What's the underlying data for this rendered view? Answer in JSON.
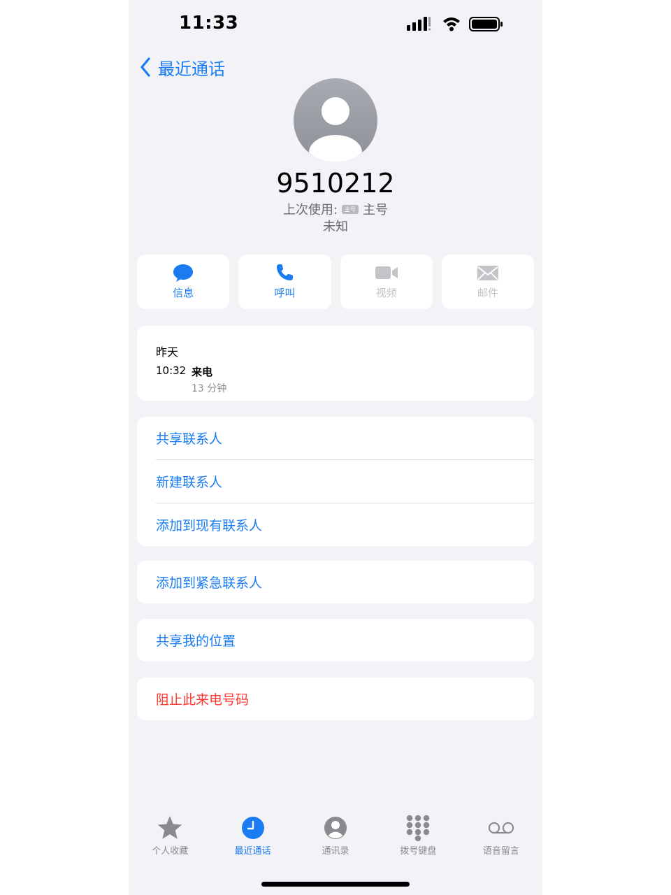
{
  "status_bar": {
    "time": "11:33"
  },
  "nav": {
    "back_label": "最近通话"
  },
  "contact": {
    "number": "9510212",
    "last_used_prefix": "上次使用:",
    "last_used_badge": "主号",
    "last_used_line": "主号",
    "location": "未知"
  },
  "actions": [
    {
      "label": "信息",
      "icon": "message-bubble-icon",
      "enabled": true
    },
    {
      "label": "呼叫",
      "icon": "phone-icon",
      "enabled": true
    },
    {
      "label": "视频",
      "icon": "video-camera-icon",
      "enabled": false
    },
    {
      "label": "邮件",
      "icon": "envelope-icon",
      "enabled": false
    }
  ],
  "call_log": {
    "day": "昨天",
    "time": "10:32",
    "type": "来电",
    "duration": "13 分钟"
  },
  "options_group1": [
    "共享联系人",
    "新建联系人",
    "添加到现有联系人"
  ],
  "emergency": "添加到紧急联系人",
  "share_location": "共享我的位置",
  "block": "阻止此来电号码",
  "tabbar": [
    {
      "label": "个人收藏",
      "icon": "star-icon",
      "active": false
    },
    {
      "label": "最近通话",
      "icon": "clock-icon",
      "active": true
    },
    {
      "label": "通讯录",
      "icon": "contacts-person-icon",
      "active": false
    },
    {
      "label": "拨号键盘",
      "icon": "keypad-icon",
      "active": false
    },
    {
      "label": "语音留言",
      "icon": "voicemail-icon",
      "active": false
    }
  ],
  "colors": {
    "accent": "#1a7cf0",
    "destructive": "#ff3b30",
    "background": "#f2f2f7",
    "disabled": "#c4c4c8"
  }
}
